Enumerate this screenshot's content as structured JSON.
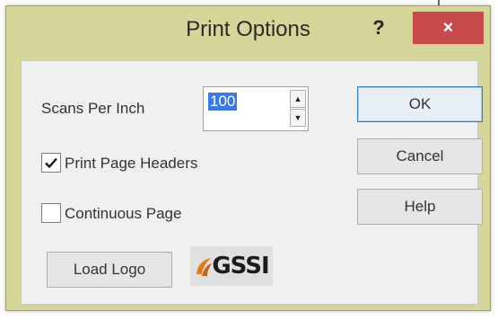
{
  "dialog": {
    "title": "Print Options",
    "help_glyph": "?",
    "close_glyph": "×"
  },
  "scans": {
    "label": "Scans Per Inch",
    "value": "100",
    "up_glyph": "▲",
    "down_glyph": "▼"
  },
  "checkboxes": [
    {
      "label": "Print Page Headers",
      "checked": true
    },
    {
      "label": "Continuous Page",
      "checked": false
    }
  ],
  "buttons": {
    "ok": "OK",
    "cancel": "Cancel",
    "help": "Help",
    "load_logo": "Load Logo"
  },
  "logo": {
    "text": "GSSI",
    "accent_color": "#e07a1f"
  },
  "colors": {
    "title_bar": "#d6d59a",
    "close_button": "#c94a4a",
    "selection": "#3b7ae0"
  }
}
